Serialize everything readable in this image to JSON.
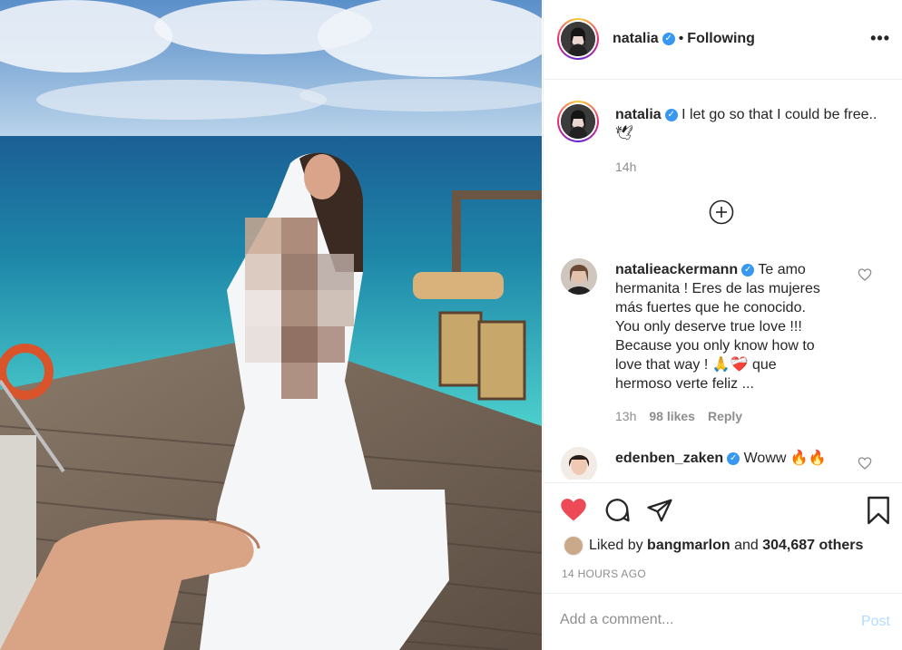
{
  "colors": {
    "accent": "#3897f0",
    "like_red": "#ed4956",
    "muted": "#8e8e8e"
  },
  "header": {
    "username": "natalia",
    "verified_icon": "verified-badge-icon",
    "separator": "•",
    "follow_status": "Following",
    "more_icon": "more-options-icon"
  },
  "caption": {
    "username": "natalia",
    "text": "I let go so that I could be free.. 🕊",
    "time": "14h"
  },
  "load_more_icon": "plus-circle-icon",
  "comments": [
    {
      "username": "natalieackermann",
      "text": "Te amo hermanita ! Eres de las mujeres más fuertes que he conocido. You only deserve true love !!! Because you only know how to love that way ! 🙏❤️‍🩹 que hermoso verte feliz ...",
      "time": "13h",
      "likes": "98 likes",
      "reply": "Reply"
    },
    {
      "username": "edenben_zaken",
      "text": "Woww 🔥🔥"
    }
  ],
  "actions": {
    "like_icon": "heart-filled-icon",
    "comment_icon": "comment-icon",
    "share_icon": "share-icon",
    "save_icon": "bookmark-icon",
    "liked_by_prefix": "Liked by",
    "liked_by_user": "bangmarlon",
    "liked_by_joiner": "and",
    "liked_by_others": "304,687 others",
    "time_ago": "14 HOURS AGO"
  },
  "add_comment": {
    "placeholder": "Add a comment...",
    "post_label": "Post"
  }
}
